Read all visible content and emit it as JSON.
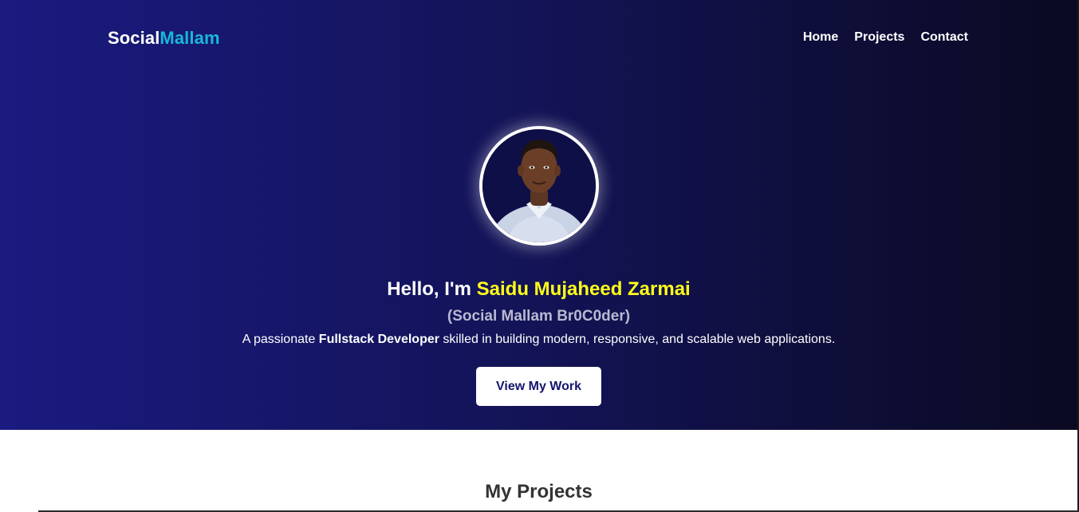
{
  "header": {
    "logo_part1": "Social",
    "logo_part2": "Mallam",
    "nav": [
      {
        "label": "Home"
      },
      {
        "label": "Projects"
      },
      {
        "label": "Contact"
      }
    ]
  },
  "hero": {
    "greeting_prefix": "Hello, I'm ",
    "name": "Saidu Mujaheed Zarmai",
    "subtitle": "(Social Mallam Br0C0der)",
    "desc_prefix": "A passionate ",
    "desc_bold": "Fullstack Developer",
    "desc_suffix": " skilled in building modern, responsive, and scalable web applications.",
    "cta_label": "View My Work"
  },
  "projects": {
    "title": "My Projects"
  },
  "colors": {
    "accent_cyan": "#18b8d8",
    "accent_yellow": "#ffff1a",
    "hero_start": "#1a1a80",
    "hero_end": "#0a0a22"
  }
}
